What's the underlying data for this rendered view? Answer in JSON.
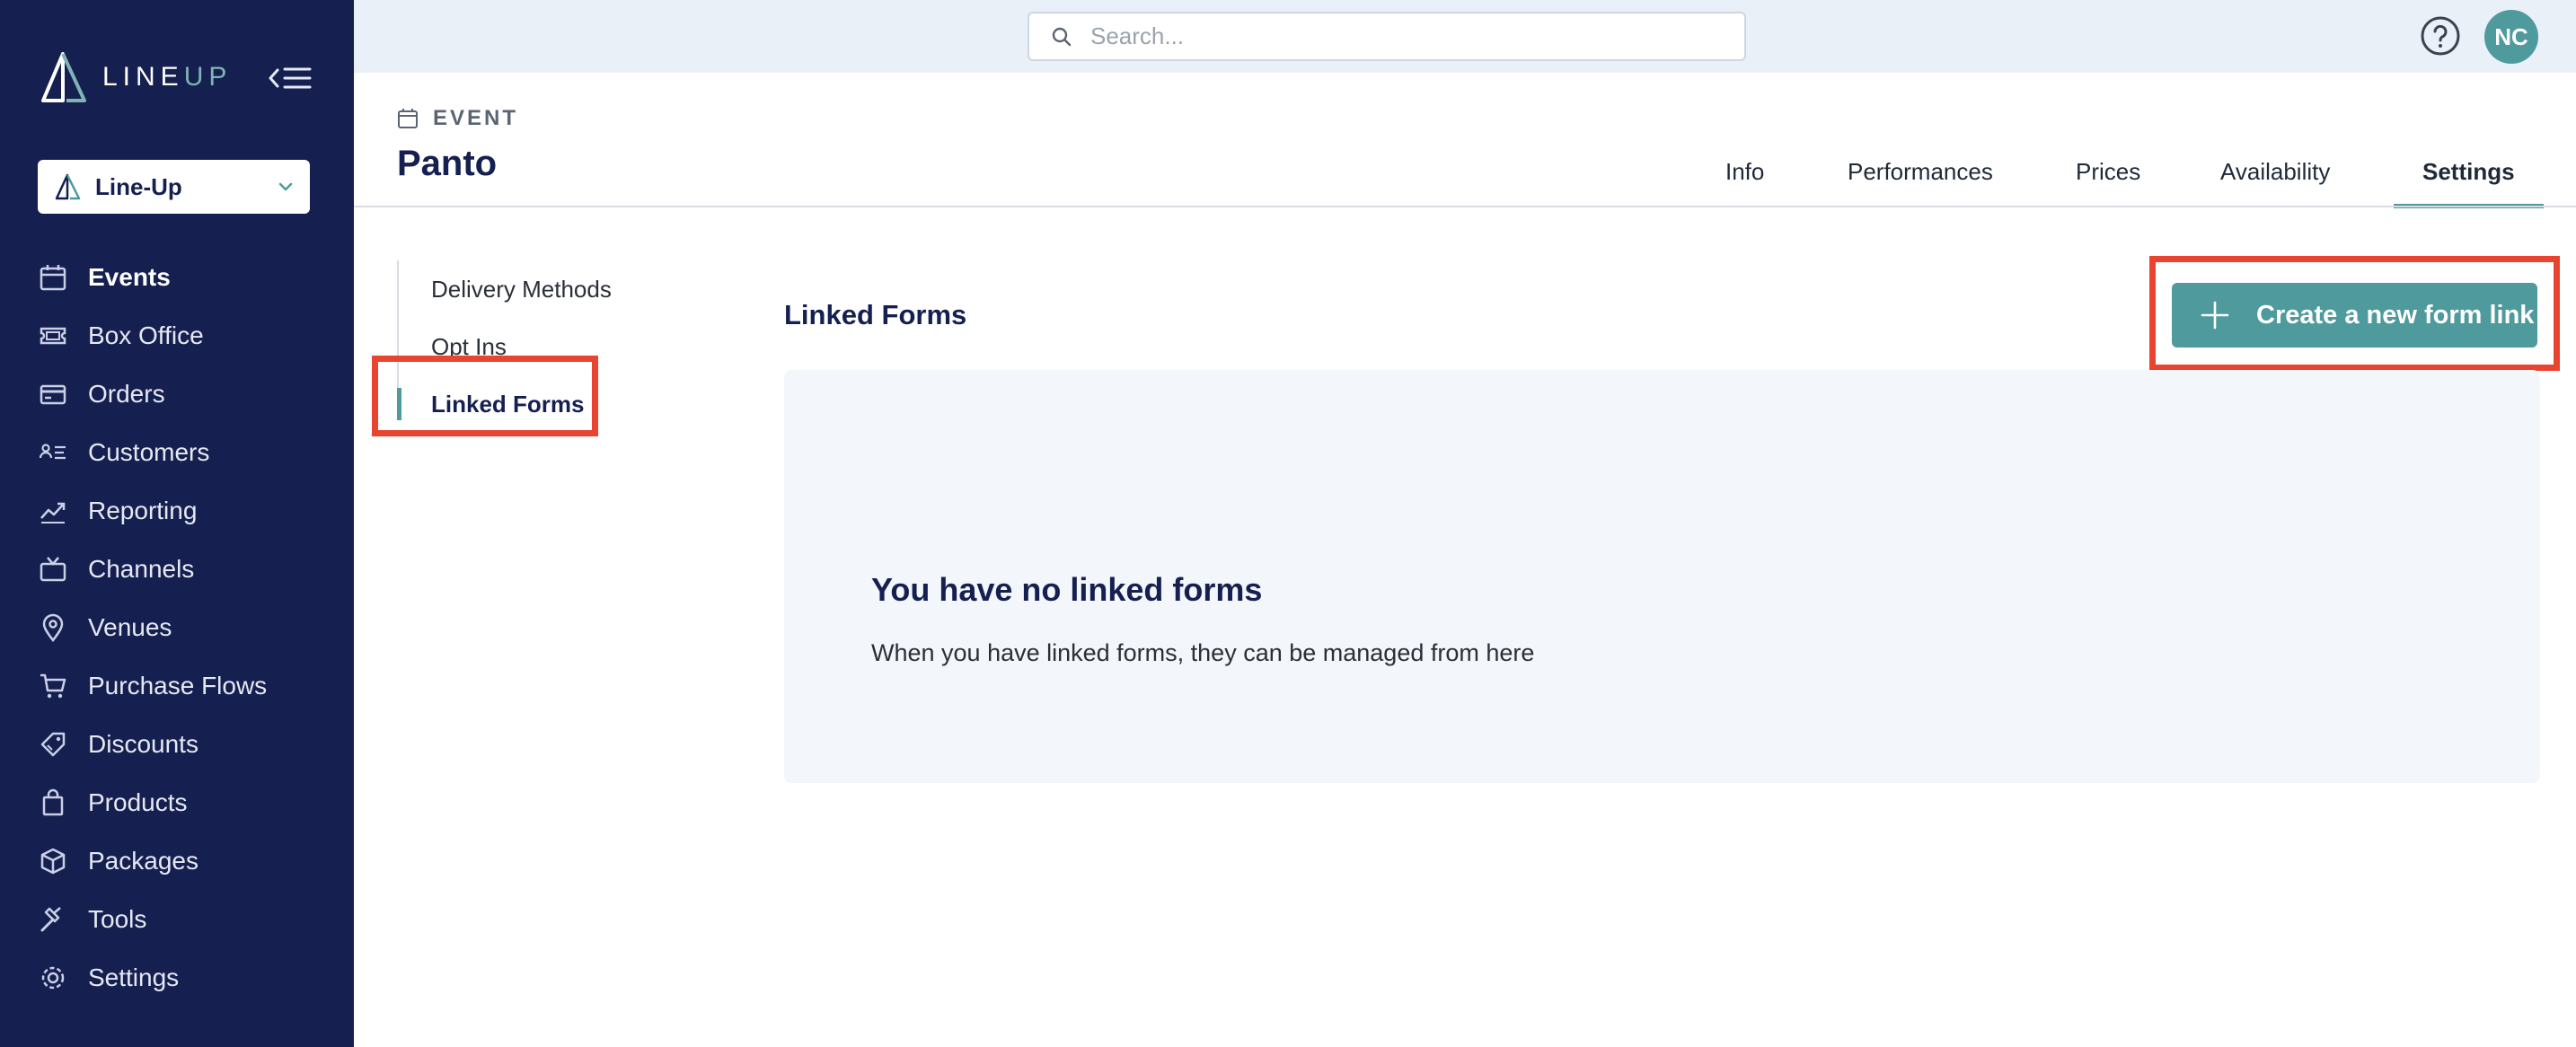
{
  "brand": {
    "logo_text_line": "LINE",
    "logo_text_up": "UP"
  },
  "org_selector": {
    "label": "Line-Up"
  },
  "sidebar": {
    "items": [
      {
        "label": "Events",
        "icon": "calendar-icon",
        "active": true
      },
      {
        "label": "Box Office",
        "icon": "ticket-icon"
      },
      {
        "label": "Orders",
        "icon": "credit-card-icon"
      },
      {
        "label": "Customers",
        "icon": "customers-list-icon"
      },
      {
        "label": "Reporting",
        "icon": "trend-chart-icon"
      },
      {
        "label": "Channels",
        "icon": "tv-icon"
      },
      {
        "label": "Venues",
        "icon": "map-pin-icon"
      },
      {
        "label": "Purchase Flows",
        "icon": "cart-icon"
      },
      {
        "label": "Discounts",
        "icon": "tag-icon"
      },
      {
        "label": "Products",
        "icon": "shopping-bag-icon"
      },
      {
        "label": "Packages",
        "icon": "box-icon"
      },
      {
        "label": "Tools",
        "icon": "hammer-icon"
      },
      {
        "label": "Settings",
        "icon": "gear-icon"
      }
    ]
  },
  "topbar": {
    "search_placeholder": "Search...",
    "avatar_initials": "NC"
  },
  "header": {
    "kicker": "EVENT",
    "title": "Panto",
    "tabs": [
      {
        "label": "Info"
      },
      {
        "label": "Performances"
      },
      {
        "label": "Prices"
      },
      {
        "label": "Availability"
      },
      {
        "label": "Settings",
        "active": true
      }
    ]
  },
  "settings_nav": {
    "items": [
      {
        "label": "Delivery Methods"
      },
      {
        "label": "Opt Ins"
      },
      {
        "label": "Linked Forms",
        "active": true
      }
    ]
  },
  "main": {
    "section_title": "Linked Forms",
    "create_button_label": "Create a new form link",
    "empty_title": "You have no linked forms",
    "empty_description": "When you have linked forms, they can be managed from here"
  },
  "colors": {
    "sidebar_bg": "#152050",
    "accent": "#4e9a9c",
    "highlight": "#e8442f",
    "topbar_bg": "#e9f0f8"
  }
}
